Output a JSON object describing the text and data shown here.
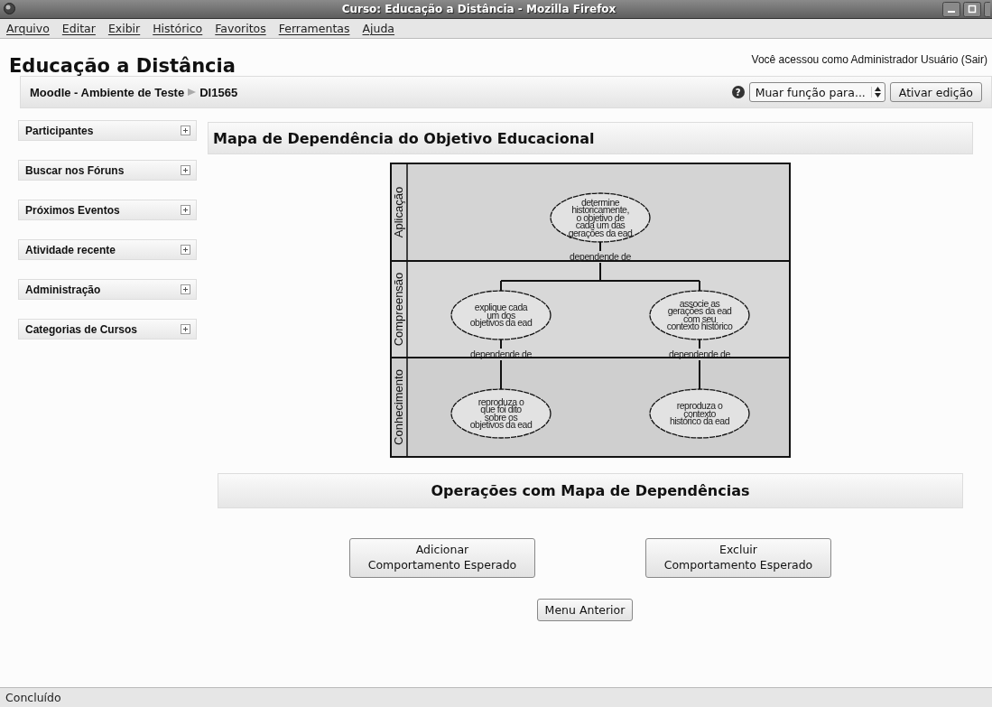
{
  "window": {
    "title": "Curso: Educação a Distância - Mozilla Firefox"
  },
  "menu": [
    "Arquivo",
    "Editar",
    "Exibir",
    "Histórico",
    "Favoritos",
    "Ferramentas",
    "Ajuda"
  ],
  "header": {
    "site_title": "Educação a Distância",
    "login_info": "Você acessou como Administrador Usuário (Sair)"
  },
  "navbar": {
    "breadcrumb": [
      "Moodle - Ambiente de Teste",
      "DI1565"
    ],
    "help": "?",
    "role_select": "Muar função para...",
    "edit_button": "Ativar edição"
  },
  "sidebar": [
    {
      "title": "Participantes",
      "expanded": false
    },
    {
      "title": "Buscar nos Fóruns",
      "expanded": false
    },
    {
      "title": "Próximos Eventos",
      "expanded": false
    },
    {
      "title": "Atividade recente",
      "expanded": false
    },
    {
      "title": "Administração",
      "expanded": false
    },
    {
      "title": "Categorias de Cursos",
      "expanded": false
    }
  ],
  "main": {
    "heading": "Mapa de Dependência do Objetivo Educacional",
    "diagram": {
      "levels": [
        "Aplicação",
        "Compreensão",
        "Conhecimento"
      ],
      "root": {
        "lines": [
          "determine",
          "historicamente,",
          "o objetivo de",
          "cada um das",
          "gerações da ead"
        ],
        "edge_label": "dependende de",
        "children": [
          {
            "lines": [
              "explique cada",
              "um dos",
              "objetivos da ead"
            ],
            "edge_label": "dependende de",
            "children": [
              {
                "lines": [
                  "reproduza o",
                  "que foi dito",
                  "sobre os",
                  "objetivos da ead"
                ]
              }
            ]
          },
          {
            "lines": [
              "associe as",
              "gerações da ead",
              "com seu",
              "contexto histórico"
            ],
            "edge_label": "dependende de",
            "children": [
              {
                "lines": [
                  "reproduza o",
                  "contexto",
                  "histórico da ead"
                ]
              }
            ]
          }
        ]
      }
    },
    "operations_heading": "Operações com Mapa de Dependências",
    "actions": [
      [
        "Adicionar",
        "Comportamento Esperado"
      ],
      [
        "Excluir",
        "Comportamento Esperado"
      ]
    ],
    "back_button": "Menu Anterior"
  },
  "status_bar": "Concluído"
}
